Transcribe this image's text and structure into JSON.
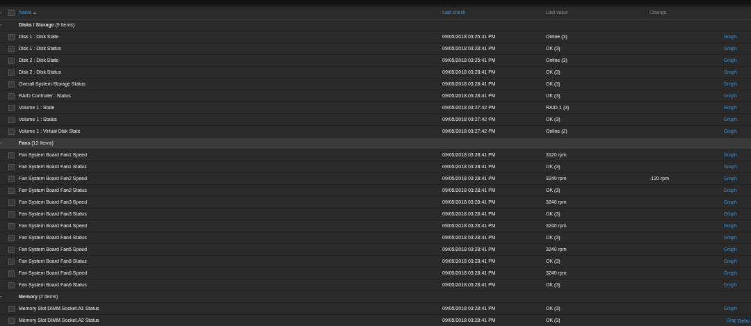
{
  "header": {
    "select_all": {
      "checked": false
    },
    "columns": [
      {
        "label": "Name",
        "sortable": true,
        "sorted": true
      },
      {
        "label": "Last check",
        "sortable": true,
        "sorted": false
      },
      {
        "label": "Last value",
        "sortable": false,
        "sorted": false
      },
      {
        "label": "Change",
        "sortable": false,
        "sorted": false
      }
    ]
  },
  "groups": [
    {
      "title": "**Disks / Storage** (9 Items)",
      "selected": false,
      "rows": [
        {
          "name": "Disk 1 : Disk State",
          "last_check": "09/05/2018 03:25:41 PM",
          "last_value": "Online (3)",
          "checked": false,
          "link": "Graph"
        },
        {
          "name": "Disk 1 : Disk Status",
          "last_check": "09/05/2018 03:28:41 PM",
          "last_value": "OK (3)",
          "checked": false,
          "link": "Graph"
        },
        {
          "name": "Disk 2 : Disk State",
          "last_check": "09/05/2018 03:25:41 PM",
          "last_value": "Online (3)",
          "checked": false,
          "link": "Graph"
        },
        {
          "name": "Disk 2 : Disk Status",
          "last_check": "09/05/2018 03:28:41 PM",
          "last_value": "OK (3)",
          "checked": false,
          "link": "Graph"
        },
        {
          "name": "Overall System Storage Status",
          "last_check": "09/05/2018 03:28:41 PM",
          "last_value": "OK (3)",
          "checked": false,
          "link": "Graph"
        },
        {
          "name": "RAID Controller : Status",
          "last_check": "09/05/2018 03:28:41 PM",
          "last_value": "OK (3)",
          "checked": false,
          "link": "Graph"
        },
        {
          "name": "Volume 1 : State",
          "last_check": "09/05/2018 03:27:42 PM",
          "last_value": "RAID-1 (3)",
          "checked": false,
          "link": "Graph"
        },
        {
          "name": "Volume 1 : Status",
          "last_check": "09/05/2018 03:27:42 PM",
          "last_value": "OK (3)",
          "checked": false,
          "link": "Graph"
        },
        {
          "name": "Volume 1 : Virtual Disk State",
          "last_check": "09/05/2018 03:27:42 PM",
          "last_value": "Online (2)",
          "checked": false,
          "link": "Graph"
        }
      ]
    },
    {
      "title": "**Fans** (12 Items)",
      "selected": true,
      "rows": [
        {
          "name": "Fan System Board Fan1 Speed",
          "last_check": "09/05/2018 03:28:41 PM",
          "last_value": "3120 rpm",
          "checked": false,
          "link": "Graph"
        },
        {
          "name": "Fan System Board Fan1 Status",
          "last_check": "09/05/2018 03:28:41 PM",
          "last_value": "OK (3)",
          "checked": false,
          "link": "Graph"
        },
        {
          "name": "Fan System Board Fan2 Speed",
          "last_check": "09/05/2018 03:28:41 PM",
          "last_value": "3240 rpm",
          "change": "-120 rpm",
          "checked": false,
          "link": "Graph"
        },
        {
          "name": "Fan System Board Fan2 Status",
          "last_check": "09/05/2018 03:28:41 PM",
          "last_value": "OK (3)",
          "checked": false,
          "link": "Graph"
        },
        {
          "name": "Fan System Board Fan3 Speed",
          "last_check": "09/05/2018 03:28:41 PM",
          "last_value": "3240 rpm",
          "checked": false,
          "link": "Graph"
        },
        {
          "name": "Fan System Board Fan3 Status",
          "last_check": "09/05/2018 03:28:41 PM",
          "last_value": "OK (3)",
          "checked": false,
          "link": "Graph"
        },
        {
          "name": "Fan System Board Fan4 Speed",
          "last_check": "09/05/2018 03:28:41 PM",
          "last_value": "3240 rpm",
          "checked": false,
          "link": "Graph"
        },
        {
          "name": "Fan System Board Fan4 Status",
          "last_check": "09/05/2018 03:28:41 PM",
          "last_value": "OK (3)",
          "checked": false,
          "link": "Graph"
        },
        {
          "name": "Fan System Board Fan5 Speed",
          "last_check": "09/05/2018 03:28:41 PM",
          "last_value": "3240 rpm",
          "checked": false,
          "link": "Graph"
        },
        {
          "name": "Fan System Board Fan5 Status",
          "last_check": "09/05/2018 03:28:41 PM",
          "last_value": "OK (3)",
          "checked": false,
          "link": "Graph"
        },
        {
          "name": "Fan System Board Fan6 Speed",
          "last_check": "09/05/2018 03:28:41 PM",
          "last_value": "3240 rpm",
          "checked": false,
          "link": "Graph"
        },
        {
          "name": "Fan System Board Fan6 Status",
          "last_check": "09/05/2018 03:28:41 PM",
          "last_value": "OK (3)",
          "checked": false,
          "link": "Graph"
        }
      ]
    },
    {
      "title": "**Memory** (2 Items)",
      "selected": false,
      "rows": [
        {
          "name": "Memory Slot DIMM.Socket.A1 Status",
          "last_check": "09/05/2018 03:28:41 PM",
          "last_value": "OK (3)",
          "checked": false,
          "link": "Graph"
        },
        {
          "name": "Memory Slot DIMM.Socket.A2 Status",
          "last_check": "09/05/2018 03:28:41 PM",
          "last_value": "OK (3)",
          "checked": false,
          "link": "Grap"
        }
      ]
    }
  ],
  "debug_button": "Debu"
}
